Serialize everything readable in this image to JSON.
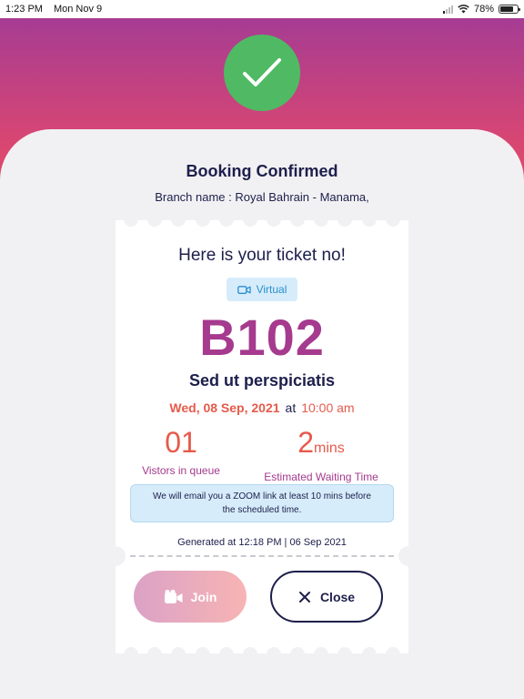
{
  "status_bar": {
    "time": "1:23 PM",
    "date": "Mon Nov 9",
    "battery": "78%",
    "battery_level": 0.78
  },
  "header": {
    "title": "Booking Confirmed",
    "branch": "Branch name : Royal Bahrain - Manama,"
  },
  "ticket": {
    "heading": "Here is your ticket no!",
    "badge_icon": "video-camera-icon",
    "badge_label": "Virtual",
    "number": "B102",
    "service": "Sed ut perspiciatis",
    "date": "Wed, 08 Sep, 2021",
    "at": "at",
    "time": "10:00 am",
    "queue_value": "01",
    "queue_label": "Vistors in queue",
    "wait_value": "2",
    "wait_unit": "mins",
    "wait_label": "Estimated Waiting Time",
    "info": "We will email you a ZOOM link at least 10 mins before the scheduled time.",
    "generated": "Generated at 12:18 PM | 06 Sep 2021"
  },
  "actions": {
    "join_label": "Join",
    "join_icon": "video-camera-icon",
    "close_label": "Close",
    "close_icon": "close-icon"
  },
  "colors": {
    "brand_purple": "#a53a8e",
    "accent_red": "#e65a4b",
    "navy": "#1d1f4b",
    "success_green": "#4fba63",
    "info_blue": "#d6ecfa"
  }
}
